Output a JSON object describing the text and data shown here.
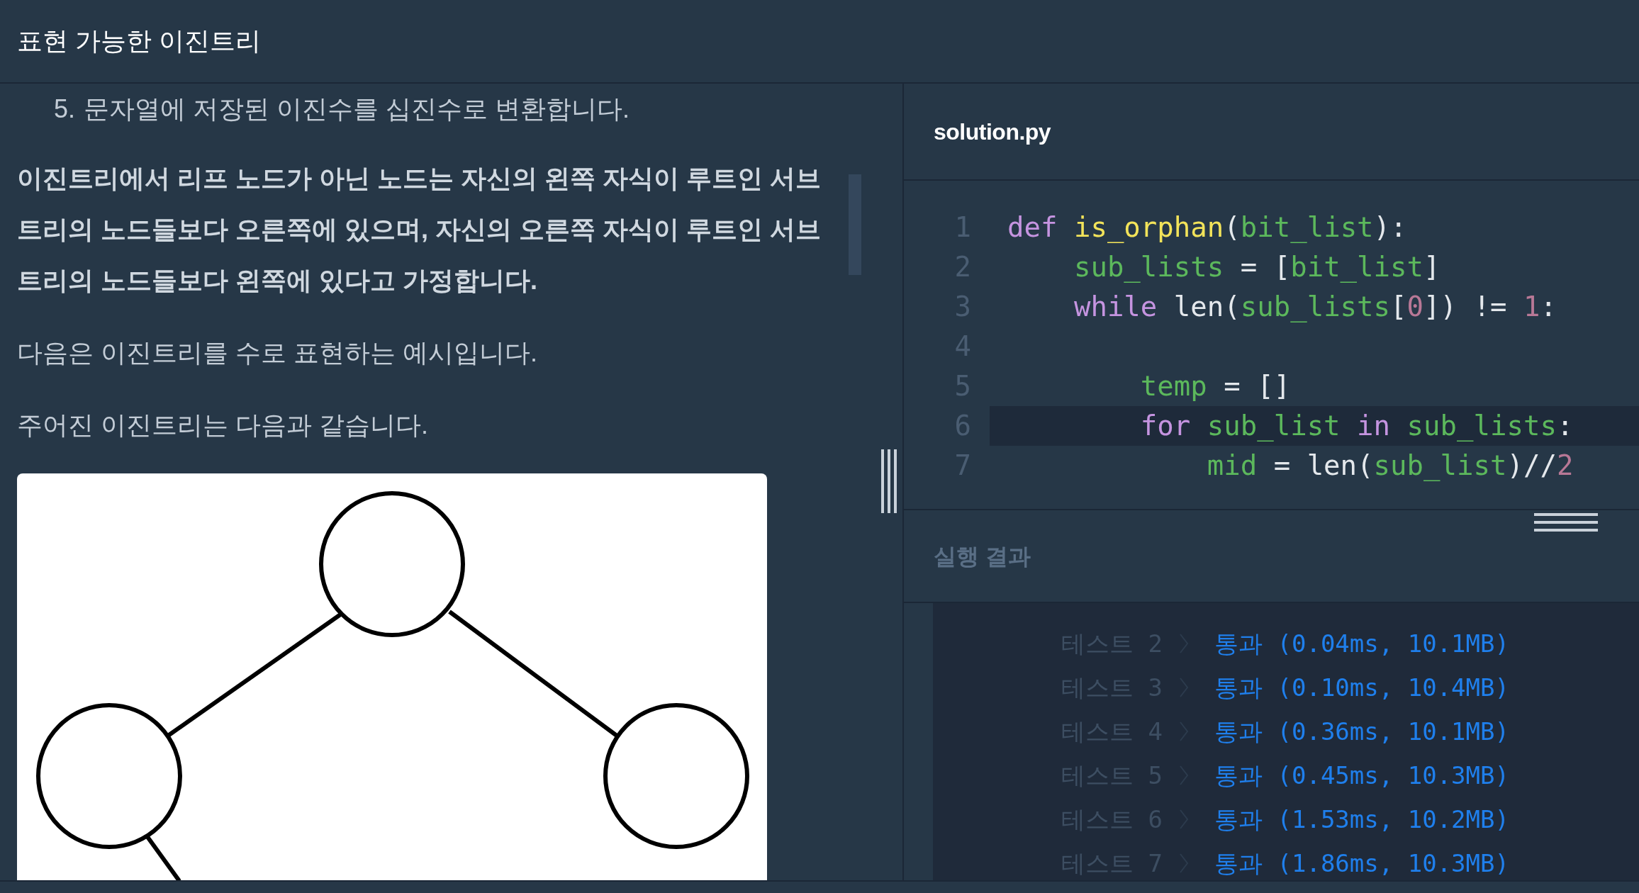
{
  "header": {
    "title": "표현 가능한 이진트리"
  },
  "problem": {
    "list_items": [
      {
        "number": "5.",
        "text": "문자열에 저장된 이진수를 십진수로 변환합니다."
      }
    ],
    "paragraphs": [
      {
        "bold": true,
        "text": "이진트리에서 리프 노드가 아닌 노드는 자신의 왼쪽 자식이 루트인 서브트리의 노드들보다 오른쪽에 있으며, 자신의 오른쪽 자식이 루트인 서브트리의 노드들보다 왼쪽에 있다고 가정합니다."
      },
      {
        "bold": false,
        "text": "다음은 이진트리를 수로 표현하는 예시입니다."
      },
      {
        "bold": false,
        "text": "주어진 이진트리는 다음과 같습니다."
      }
    ]
  },
  "editor": {
    "filename": "solution.py",
    "lines": [
      {
        "number": "1",
        "selected": false,
        "tokens": [
          {
            "text": "def",
            "color": "#c594e0"
          },
          {
            "text": " is_orphan",
            "color": "#f2e35a"
          },
          {
            "text": "(",
            "color": "#e4e8ec"
          },
          {
            "text": "bit_list",
            "color": "#5cb85c"
          },
          {
            "text": "):",
            "color": "#e4e8ec"
          }
        ]
      },
      {
        "number": "2",
        "selected": false,
        "tokens": [
          {
            "text": "    sub_lists",
            "color": "#5cb85c"
          },
          {
            "text": " = [",
            "color": "#e4e8ec"
          },
          {
            "text": "bit_list",
            "color": "#5cb85c"
          },
          {
            "text": "]",
            "color": "#e4e8ec"
          }
        ]
      },
      {
        "number": "3",
        "selected": false,
        "tokens": [
          {
            "text": "    while",
            "color": "#c594e0"
          },
          {
            "text": " len(",
            "color": "#e4e8ec"
          },
          {
            "text": "sub_lists",
            "color": "#5cb85c"
          },
          {
            "text": "[",
            "color": "#e4e8ec"
          },
          {
            "text": "0",
            "color": "#b87896"
          },
          {
            "text": "]) !=",
            "color": "#e4e8ec"
          },
          {
            "text": " 1",
            "color": "#b87896"
          },
          {
            "text": ":",
            "color": "#e4e8ec"
          }
        ]
      },
      {
        "number": "4",
        "selected": false
      },
      {
        "number": "5",
        "selected": false,
        "tokens": [
          {
            "text": "        temp",
            "color": "#5cb85c"
          },
          {
            "text": " = []",
            "color": "#e4e8ec"
          }
        ]
      },
      {
        "number": "6",
        "selected": true,
        "tokens": [
          {
            "text": "        for",
            "color": "#c594e0"
          },
          {
            "text": " sub_list",
            "color": "#5cb85c"
          },
          {
            "text": " in",
            "color": "#c594e0"
          },
          {
            "text": " sub_lists",
            "color": "#5cb85c"
          },
          {
            "text": ":",
            "color": "#e4e8ec"
          }
        ]
      },
      {
        "number": "7",
        "selected": false,
        "tokens": [
          {
            "text": "            mid",
            "color": "#5cb85c"
          },
          {
            "text": " = len(",
            "color": "#e4e8ec"
          },
          {
            "text": "sub_list",
            "color": "#5cb85c"
          },
          {
            "text": ")//",
            "color": "#e4e8ec"
          },
          {
            "text": "2",
            "color": "#b87896"
          }
        ]
      }
    ]
  },
  "results": {
    "title": "실행 결과",
    "rows": [
      {
        "label": "테스트 2",
        "result": "통과 (0.04ms, 10.1MB)"
      },
      {
        "label": "테스트 3",
        "result": "통과 (0.10ms, 10.4MB)"
      },
      {
        "label": "테스트 4",
        "result": "통과 (0.36ms, 10.1MB)"
      },
      {
        "label": "테스트 5",
        "result": "통과 (0.45ms, 10.3MB)"
      },
      {
        "label": "테스트 6",
        "result": "통과 (1.53ms, 10.2MB)"
      },
      {
        "label": "테스트 7",
        "result": "통과 (1.86ms, 10.3MB)"
      }
    ]
  }
}
